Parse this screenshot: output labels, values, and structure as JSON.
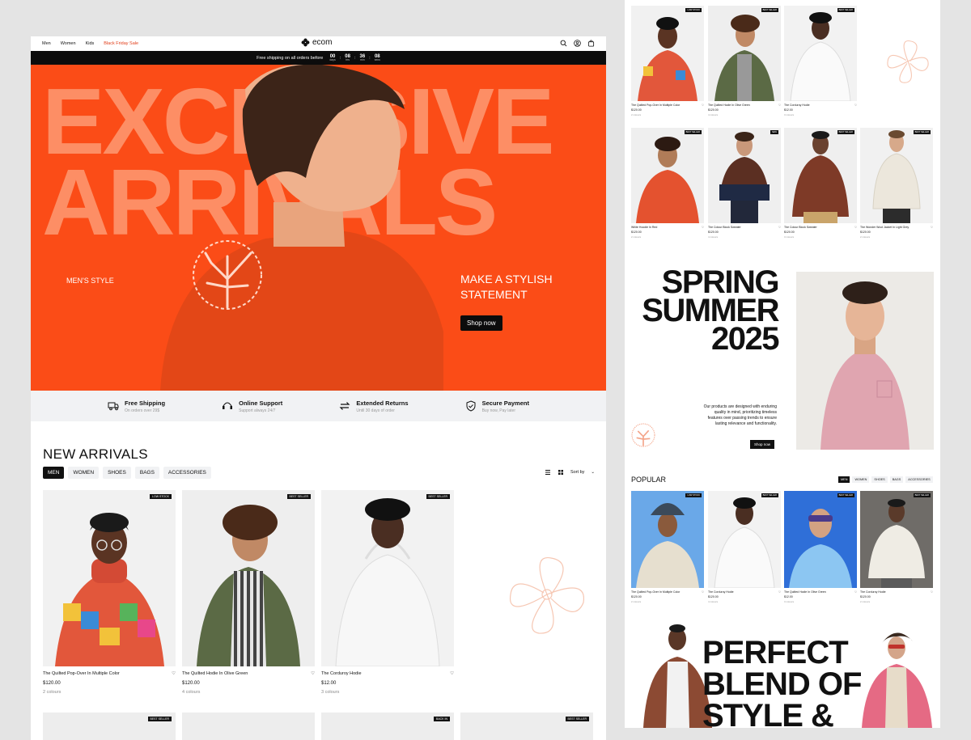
{
  "nav": {
    "links": [
      "Men",
      "Women",
      "Kids",
      "Black Friday Sale"
    ],
    "logo": "ecom",
    "icons": [
      "search-icon",
      "user-icon",
      "bag-icon"
    ]
  },
  "announcement": {
    "text": "Free shipping on all orders before",
    "countdown": [
      {
        "v": "00",
        "u": "days"
      },
      {
        "v": "08",
        "u": "hrs"
      },
      {
        "v": "36",
        "u": "min"
      },
      {
        "v": "08",
        "u": "secs"
      }
    ]
  },
  "hero": {
    "line1": "EXCLUSIVE",
    "line2": "ARRIVALS",
    "mens_style": "MEN'S STYLE",
    "tagline": "MAKE A STYLISH STATEMENT",
    "cta": "Shop now",
    "accent": "#fb4c17"
  },
  "features": [
    {
      "icon": "truck-icon",
      "title": "Free Shipping",
      "sub": "On orders over 29$"
    },
    {
      "icon": "headset-icon",
      "title": "Online Support",
      "sub": "Support  always 24/7"
    },
    {
      "icon": "returns-icon",
      "title": "Extended Returns",
      "sub": "Until 30 days of order"
    },
    {
      "icon": "shield-icon",
      "title": "Secure Payment",
      "sub": "Buy now, Pay later"
    }
  ],
  "new_arrivals": {
    "title": "NEW ARRIVALS",
    "tabs": [
      "MEN",
      "WOMEN",
      "SHOES",
      "BAGS",
      "ACCESSORIES"
    ],
    "sort": "Sort by",
    "products": [
      {
        "name": "The Quilted Pop-Over In Multiple Color",
        "price": "$120.00",
        "colors": "2 colours",
        "tag": "LOW STOCK"
      },
      {
        "name": "The Quilted Hodie In Olive Green",
        "price": "$120.00",
        "colors": "4 colours",
        "tag": "BEST SELLER"
      },
      {
        "name": "The Corduroy Hodie",
        "price": "$12.00",
        "colors": "3 colours",
        "tag": "BEST SELLER"
      }
    ],
    "row2_tags": [
      "BEST SELLER",
      "",
      "BACK IN",
      "BEST SELLER"
    ]
  },
  "right": {
    "grid_top": [
      {
        "name": "The Quilted Pop-Over In Multiple Color",
        "price": "$120.00",
        "colors": "2 colours",
        "tag": "LOW STOCK"
      },
      {
        "name": "The Quilted Hodie In Olive Green",
        "price": "$120.00",
        "colors": "4 colours",
        "tag": "BEST SELLER"
      },
      {
        "name": "The Corduroy Hodie",
        "price": "$12.00",
        "colors": "3 colours",
        "tag": "BEST SELLER"
      }
    ],
    "grid_mid": [
      {
        "name": "White Hoodie In Red",
        "price": "$120.00",
        "colors": "2 colours",
        "tag": "BEST SELLER"
      },
      {
        "name": "The Colour Block Sweater",
        "price": "$120.00",
        "colors": "4 colours",
        "tag": "NEW"
      },
      {
        "name": "The Colour Block Sweater",
        "price": "$120.00",
        "colors": "3 colours",
        "tag": "BEST SELLER"
      },
      {
        "name": "The Wonder Wool Jacket In Light Grey",
        "price": "$120.00",
        "colors": "2 colours",
        "tag": "BEST SELLER"
      }
    ],
    "spring": {
      "l1": "SPRING",
      "l2": "SUMMER",
      "l3": "2025",
      "desc": "Our products are designed with enduring quality in mind, prioritizing timeless features over passing trends to ensure lasting relevance and functionality.",
      "cta": "Shop now"
    },
    "popular": {
      "title": "POPULAR",
      "tabs": [
        "MEN",
        "WOMEN",
        "SHOES",
        "BAGS",
        "ACCESSORIES"
      ],
      "products": [
        {
          "name": "The Quilted Pop-Over In Multiple Color",
          "price": "$120.00",
          "colors": "2 colours",
          "tag": "LOW STOCK"
        },
        {
          "name": "The Corduroy Hodie",
          "price": "$120.00",
          "colors": "4 colours",
          "tag": "BEST SELLER"
        },
        {
          "name": "The Quilted Hodie In Olive Green",
          "price": "$12.00",
          "colors": "3 colours",
          "tag": "BEST SELLER"
        },
        {
          "name": "The Corduroy Hodie",
          "price": "$120.00",
          "colors": "2 colours",
          "tag": "BEST SELLER"
        }
      ]
    },
    "blend": {
      "l1": "PERFECT",
      "l2": "BLEND OF",
      "l3": "STYLE &"
    }
  }
}
